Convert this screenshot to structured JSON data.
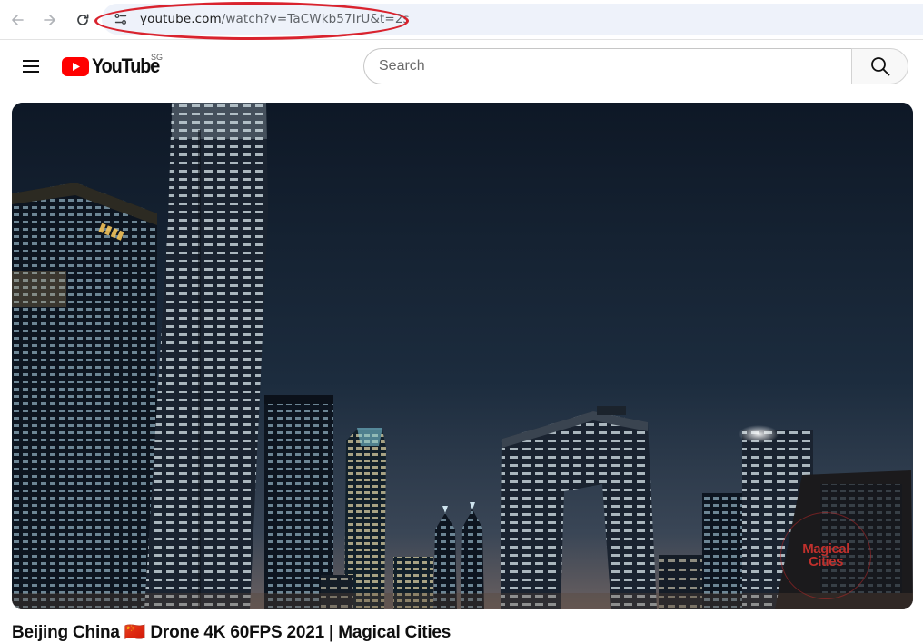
{
  "browser": {
    "url_main": "youtube.com",
    "url_rest": "/watch?v=TaCWkb57IrU&t=2s",
    "icons": {
      "back": "arrow-left-icon",
      "forward": "arrow-right-icon",
      "reload": "reload-icon",
      "site_info": "tune-icon"
    },
    "annotation_color": "#d9232e"
  },
  "masthead": {
    "logo_text": "YouTube",
    "country_code": "SG",
    "search_placeholder": "Search",
    "brand_color": "#ff0000",
    "icons": {
      "guide": "hamburger-menu-icon",
      "search": "search-icon"
    }
  },
  "video": {
    "title": "Beijing China 🇨🇳 Drone 4K 60FPS 2021 | Magical Cities",
    "title_flag": "CN",
    "watermark_line1": "Magical",
    "watermark_line2": "Cities"
  }
}
